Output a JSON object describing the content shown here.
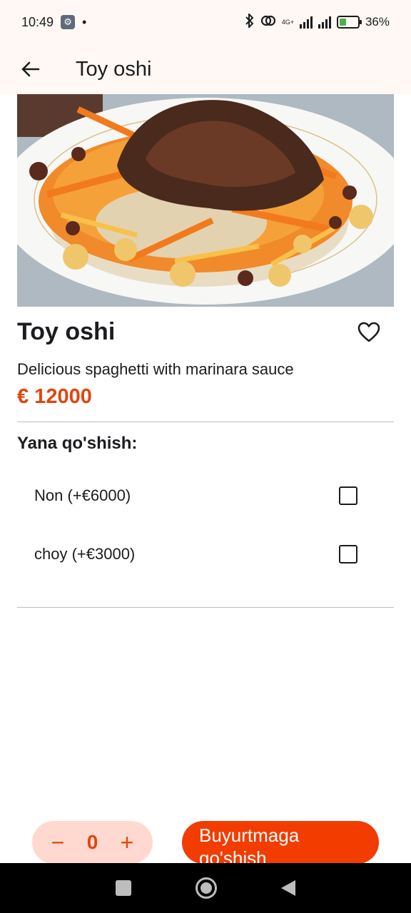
{
  "status_bar": {
    "time": "10:49",
    "dot": "•",
    "network_label": "4G+",
    "battery": "36%",
    "battery_level": 0.36,
    "icons": [
      "wrench-icon",
      "bluetooth-icon",
      "link-icon",
      "signal-icon",
      "battery-icon"
    ]
  },
  "app_bar": {
    "title": "Toy oshi",
    "back_icon": "arrow-left-icon"
  },
  "dish": {
    "name": "Toy oshi",
    "description": "Delicious spaghetti with marinara sauce",
    "price": "€ 12000",
    "favorite_icon": "heart-outline-icon"
  },
  "addons": {
    "title": "Yana qo'shish:",
    "items": [
      {
        "label": "Non (+€6000)",
        "checked": false
      },
      {
        "label": "choy (+€3000)",
        "checked": false
      }
    ]
  },
  "order": {
    "quantity": "0",
    "minus": "−",
    "plus": "+",
    "button_label": "Buyurtmaga qo'shish"
  },
  "colors": {
    "accent": "#f23c00",
    "accent_text": "#e2450e",
    "stepper_bg": "#ffd9cf",
    "app_bar_bg": "#fff8f4"
  }
}
